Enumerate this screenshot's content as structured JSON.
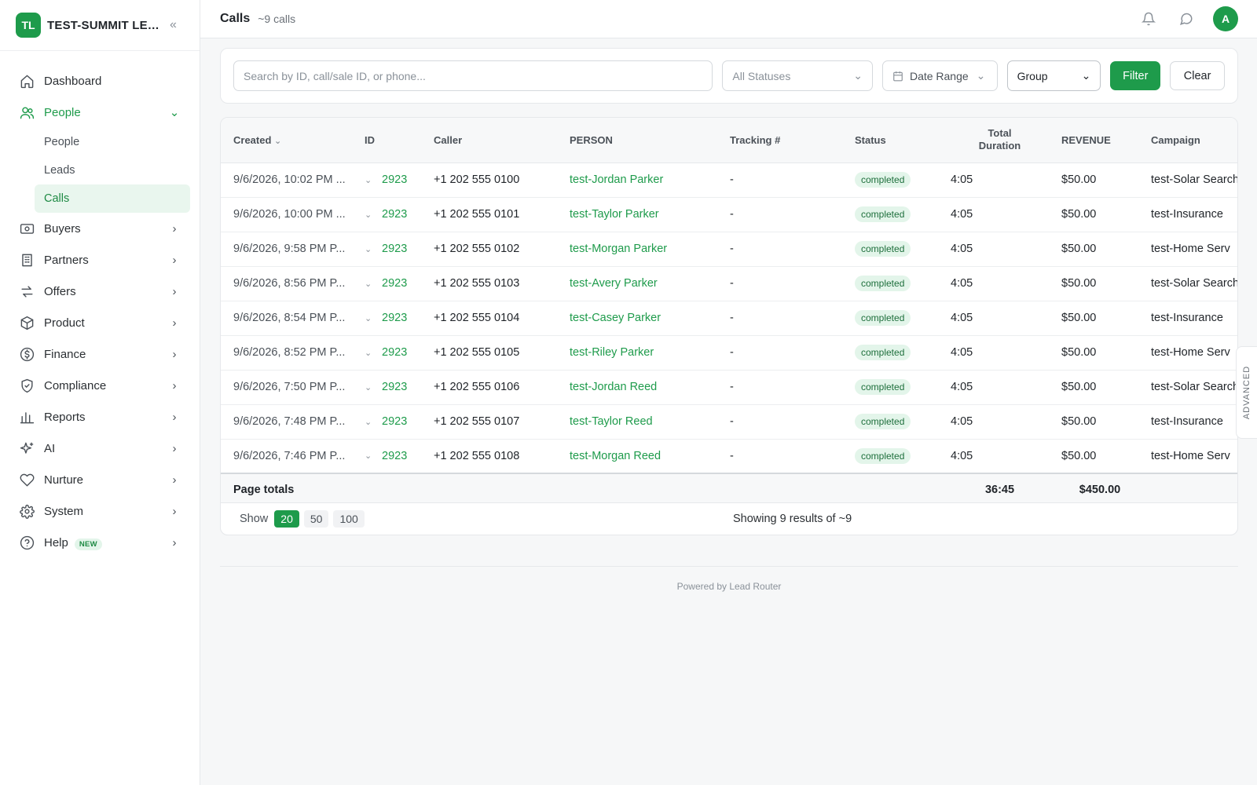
{
  "brand": {
    "initials": "TL",
    "name": "TEST-SUMMIT LEAD..."
  },
  "nav": [
    {
      "label": "Dashboard",
      "icon": "home-icon",
      "chevron": ""
    },
    {
      "label": "People",
      "icon": "users-icon",
      "chevron": "⌄",
      "open": true
    },
    {
      "label": "Buyers",
      "icon": "buyers-icon",
      "chevron": "›"
    },
    {
      "label": "Partners",
      "icon": "building-icon",
      "chevron": "›"
    },
    {
      "label": "Offers",
      "icon": "swap-icon",
      "chevron": "›"
    },
    {
      "label": "Product",
      "icon": "box-icon",
      "chevron": "›"
    },
    {
      "label": "Finance",
      "icon": "dollar-icon",
      "chevron": "›"
    },
    {
      "label": "Compliance",
      "icon": "shield-icon",
      "chevron": "›"
    },
    {
      "label": "Reports",
      "icon": "bar-chart-icon",
      "chevron": "›"
    },
    {
      "label": "AI",
      "icon": "sparkle-icon",
      "chevron": "›"
    },
    {
      "label": "Nurture",
      "icon": "heart-icon",
      "chevron": "›"
    },
    {
      "label": "System",
      "icon": "gear-icon",
      "chevron": "›"
    },
    {
      "label": "Help",
      "icon": "help-icon",
      "chevron": "›",
      "badge": "NEW"
    }
  ],
  "subnav": [
    {
      "label": "People"
    },
    {
      "label": "Leads"
    },
    {
      "label": "Calls",
      "active": true
    }
  ],
  "header": {
    "title": "Calls",
    "count": "~9 calls"
  },
  "user": {
    "initial": "A"
  },
  "filters": {
    "search_placeholder": "Search by ID, call/sale ID, or phone...",
    "status": "All Statuses",
    "date": "Date Range",
    "group": "Group",
    "filter_label": "Filter",
    "clear_label": "Clear"
  },
  "table": {
    "columns": [
      "Created",
      "ID",
      "Caller",
      "PERSON",
      "Tracking #",
      "Status",
      "Total Duration",
      "REVENUE",
      "Campaign"
    ],
    "rows": [
      {
        "created": "9/6/2026, 10:02 PM ...",
        "id": "2923",
        "caller": "+1 202 555 0100",
        "person": "test-Jordan Parker",
        "tracking": "-",
        "status": "completed",
        "duration": "4:05",
        "revenue": "$50.00",
        "campaign": "test-Solar Search"
      },
      {
        "created": "9/6/2026, 10:00 PM ...",
        "id": "2923",
        "caller": "+1 202 555 0101",
        "person": "test-Taylor Parker",
        "tracking": "-",
        "status": "completed",
        "duration": "4:05",
        "revenue": "$50.00",
        "campaign": "test-Insurance"
      },
      {
        "created": "9/6/2026, 9:58 PM P...",
        "id": "2923",
        "caller": "+1 202 555 0102",
        "person": "test-Morgan Parker",
        "tracking": "-",
        "status": "completed",
        "duration": "4:05",
        "revenue": "$50.00",
        "campaign": "test-Home Serv"
      },
      {
        "created": "9/6/2026, 8:56 PM P...",
        "id": "2923",
        "caller": "+1 202 555 0103",
        "person": "test-Avery Parker",
        "tracking": "-",
        "status": "completed",
        "duration": "4:05",
        "revenue": "$50.00",
        "campaign": "test-Solar Search"
      },
      {
        "created": "9/6/2026, 8:54 PM P...",
        "id": "2923",
        "caller": "+1 202 555 0104",
        "person": "test-Casey Parker",
        "tracking": "-",
        "status": "completed",
        "duration": "4:05",
        "revenue": "$50.00",
        "campaign": "test-Insurance"
      },
      {
        "created": "9/6/2026, 8:52 PM P...",
        "id": "2923",
        "caller": "+1 202 555 0105",
        "person": "test-Riley Parker",
        "tracking": "-",
        "status": "completed",
        "duration": "4:05",
        "revenue": "$50.00",
        "campaign": "test-Home Serv"
      },
      {
        "created": "9/6/2026, 7:50 PM P...",
        "id": "2923",
        "caller": "+1 202 555 0106",
        "person": "test-Jordan Reed",
        "tracking": "-",
        "status": "completed",
        "duration": "4:05",
        "revenue": "$50.00",
        "campaign": "test-Solar Search"
      },
      {
        "created": "9/6/2026, 7:48 PM P...",
        "id": "2923",
        "caller": "+1 202 555 0107",
        "person": "test-Taylor Reed",
        "tracking": "-",
        "status": "completed",
        "duration": "4:05",
        "revenue": "$50.00",
        "campaign": "test-Insurance"
      },
      {
        "created": "9/6/2026, 7:46 PM P...",
        "id": "2923",
        "caller": "+1 202 555 0108",
        "person": "test-Morgan Reed",
        "tracking": "-",
        "status": "completed",
        "duration": "4:05",
        "revenue": "$50.00",
        "campaign": "test-Home Serv"
      }
    ],
    "totals": {
      "label": "Page totals",
      "duration": "36:45",
      "revenue": "$450.00"
    }
  },
  "pager": {
    "show_label": "Show",
    "sizes": [
      "20",
      "50",
      "100"
    ],
    "active": "20",
    "results": "Showing 9 results of ~9"
  },
  "advanced_label": "ADVANCED",
  "footer": "Powered by Lead Router",
  "colors": {
    "accent": "#1e9b4b",
    "status_bg": "#e3f5ea"
  }
}
